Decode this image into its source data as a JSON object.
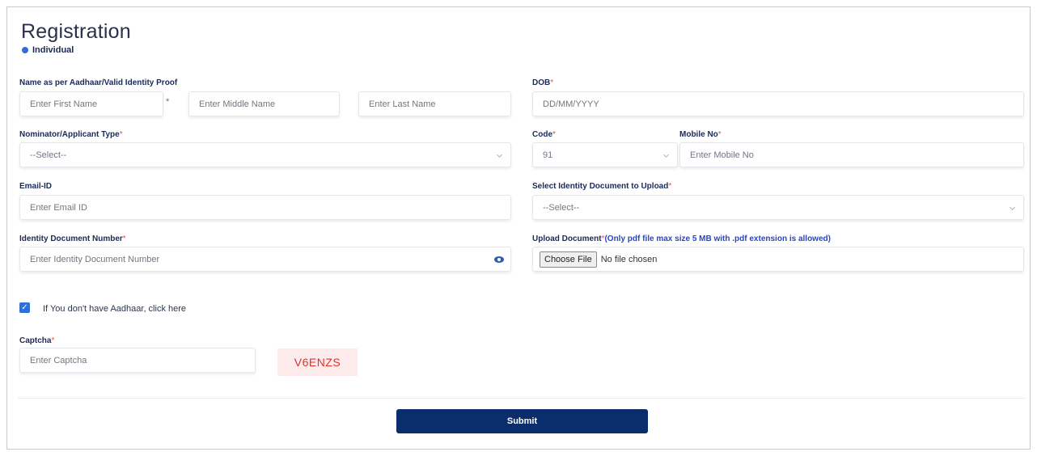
{
  "page": {
    "title": "Registration",
    "applicant_kind": "Individual"
  },
  "fields": {
    "name_label": "Name as per Aadhaar/Valid Identity Proof",
    "first_name_ph": "Enter First Name",
    "name_sep": "*",
    "middle_name_ph": "Enter Middle Name",
    "last_name_ph": "Enter Last Name",
    "dob_label": "DOB",
    "dob_ph": "DD/MM/YYYY",
    "nominator_label": "Nominator/Applicant Type",
    "nominator_value": "--Select--",
    "code_label": "Code",
    "code_value": "91",
    "mobile_label": "Mobile No",
    "mobile_ph": "Enter Mobile No",
    "email_label": "Email-ID",
    "email_ph": "Enter Email ID",
    "id_doc_select_label": "Select Identity Document to Upload",
    "id_doc_select_value": "--Select--",
    "id_doc_number_label": "Identity Document Number",
    "id_doc_number_ph": "Enter Identity Document Number",
    "upload_label": "Upload Document",
    "upload_hint": "(Only pdf file max size 5 MB with .pdf extension is allowed)",
    "choose_file_label": "Choose File",
    "file_status": "No file chosen",
    "no_aadhaar_label": "If You don't have Aadhaar, click here",
    "captcha_label": "Captcha",
    "captcha_ph": "Enter Captcha",
    "captcha_code": "V6ENZS",
    "required_mark": "*"
  },
  "actions": {
    "submit_label": "Submit"
  },
  "icons": {
    "select_arrow": "chevron-down-icon",
    "reveal": "eye-icon",
    "checkbox": "check-icon"
  },
  "colors": {
    "primary": "#0c2d6b",
    "accent": "#2f6fd8",
    "required": "#e05050",
    "captcha_text": "#e0312b",
    "captcha_bg": "#fdeceb"
  }
}
